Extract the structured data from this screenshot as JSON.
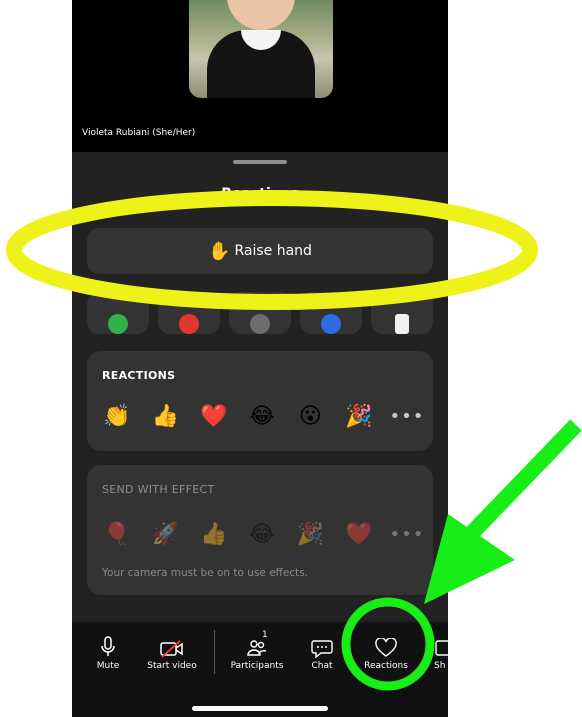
{
  "participant": {
    "name": "Violeta Rubiani (She/Her)"
  },
  "sheet": {
    "title": "Reactions",
    "raise_hand": {
      "emoji": "✋",
      "label": "Raise hand"
    },
    "feedback_colors": [
      "#2fb24c",
      "#e0362c",
      "#6d6d6d",
      "#2d6be0",
      "#f0f0f0"
    ],
    "feedback_icons": [
      "checkmark-icon",
      "no-icon",
      "slower-icon",
      "faster-icon",
      "coffee-icon"
    ]
  },
  "reactions_card": {
    "title": "REACTIONS",
    "emojis": [
      "👏",
      "👍",
      "❤️",
      "😂",
      "😮",
      "🎉"
    ],
    "more": "•••"
  },
  "effects_card": {
    "title": "SEND WITH EFFECT",
    "emojis": [
      "🎈",
      "🚀",
      "👍",
      "😂",
      "🎉",
      "❤️"
    ],
    "more": "•••",
    "note": "Your camera must be on to use effects."
  },
  "toolbar": {
    "mute": "Mute",
    "start_video": "Start video",
    "participants": "Participants",
    "participants_count": "1",
    "chat": "Chat",
    "reactions": "Reactions",
    "share": "Sh"
  },
  "annotations": {
    "ellipse_color": "#eef218",
    "arrow_color": "#17ee17",
    "circle_color": "#17ee17"
  }
}
